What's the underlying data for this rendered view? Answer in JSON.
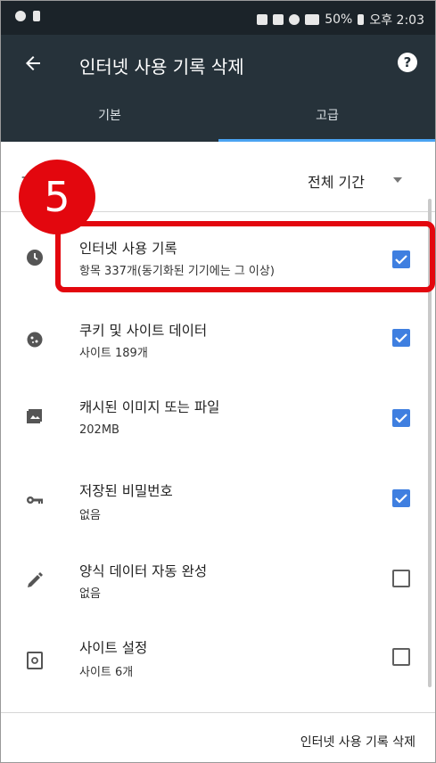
{
  "status_bar": {
    "right_text": "50%",
    "time": "오후 2:03"
  },
  "app_bar": {
    "title": "인터넷 사용 기록 삭제",
    "back_icon": "arrow-left-icon",
    "help_icon": "help-icon"
  },
  "tabs": [
    {
      "label": "기본",
      "selected": false
    },
    {
      "label": "고급",
      "selected": true
    }
  ],
  "period": {
    "label": "기간",
    "value": "전체 기간"
  },
  "items": [
    {
      "icon": "clock-icon",
      "title": "인터넷 사용 기록",
      "subtitle": "항목 337개(동기화된 기기에는 그 이상)",
      "checked": true
    },
    {
      "icon": "cookie-icon",
      "title": "쿠키 및 사이트 데이터",
      "subtitle": "사이트 189개",
      "checked": true
    },
    {
      "icon": "image-icon",
      "title": "캐시된 이미지 또는 파일",
      "subtitle": "202MB",
      "checked": true
    },
    {
      "icon": "key-icon",
      "title": "저장된 비밀번호",
      "subtitle": "없음",
      "checked": true
    },
    {
      "icon": "pencil-icon",
      "title": "양식 데이터 자동 완성",
      "subtitle": "없음",
      "checked": false
    },
    {
      "icon": "site-settings-icon",
      "title": "사이트 설정",
      "subtitle": "사이트 6개",
      "checked": false
    }
  ],
  "footer": {
    "button_label": "인터넷 사용 기록 삭제"
  },
  "annotation": {
    "step_number": "5"
  },
  "colors": {
    "appbar": "#26323a",
    "statusbar": "#1b2329",
    "accent": "#3f7fe0",
    "tab_indicator": "#4aa3f2",
    "annotation_red": "#e3070e"
  }
}
